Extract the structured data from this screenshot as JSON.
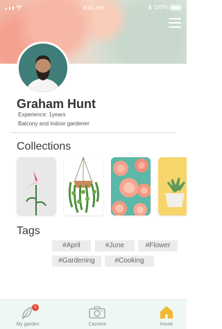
{
  "status_bar": {
    "time": "9:41 AM",
    "battery": "100%"
  },
  "profile": {
    "name": "Graham Hunt",
    "experience": "Experience: 1years",
    "description": "Balcony and indoor gardener"
  },
  "collections": {
    "title": "Collections"
  },
  "tags": {
    "title": "Tags",
    "items": [
      "#April",
      "#June",
      "#Flower",
      "#Gardening",
      "#Cooking"
    ]
  },
  "tabbar": {
    "items": [
      {
        "label": "My garden",
        "badge": "1"
      },
      {
        "label": "Camera"
      },
      {
        "label": "Home"
      }
    ]
  },
  "colors": {
    "accent": "#f2b731",
    "badge": "#e0483c",
    "tabbar_bg": "#eef7f2"
  }
}
